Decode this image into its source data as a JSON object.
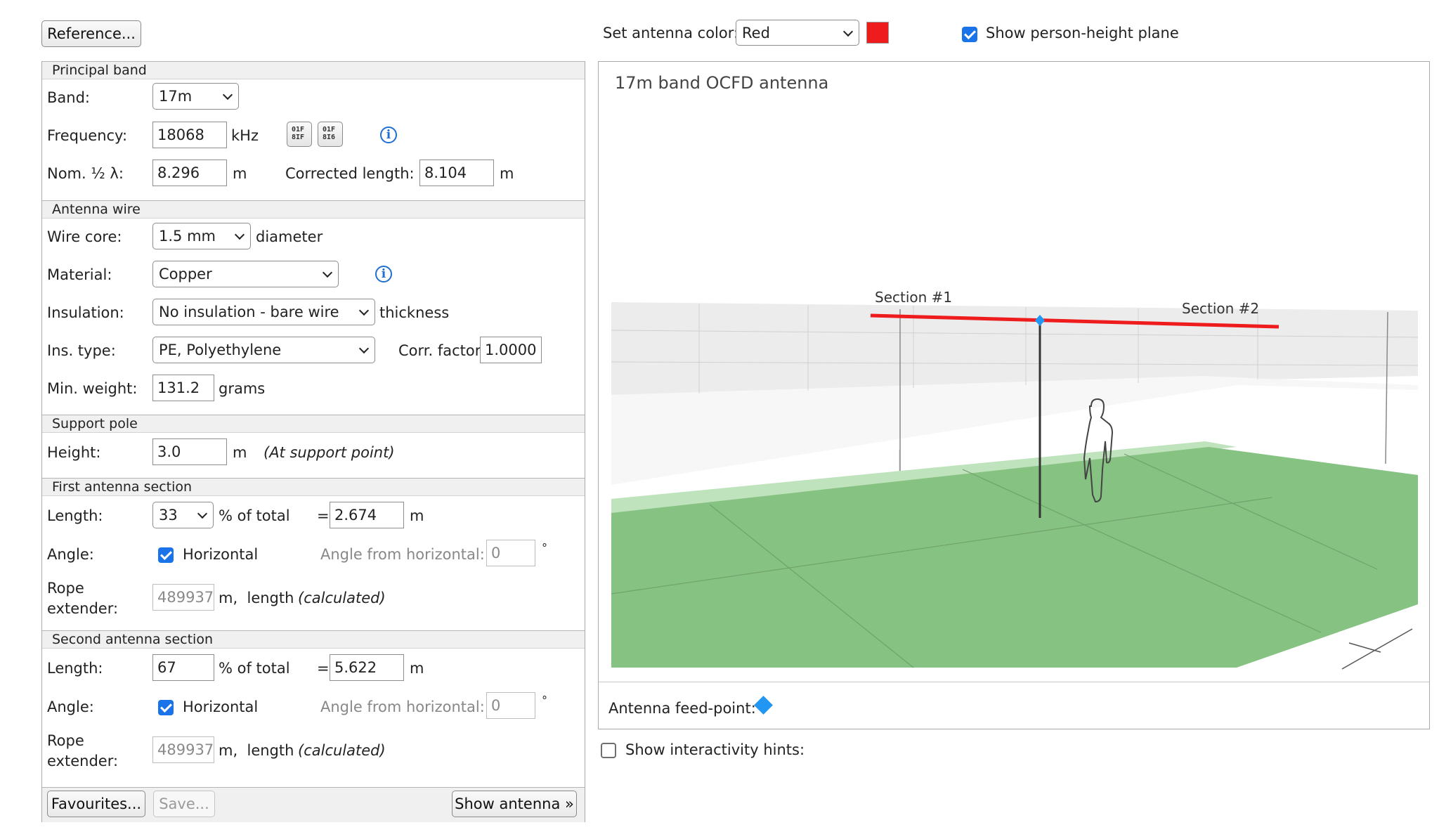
{
  "top": {
    "reference_label": "Reference...",
    "antenna_color_label": "Set antenna color:",
    "antenna_color_value": "Red",
    "antenna_color_swatch": "#ee1c1c",
    "person_plane_label": "Show person-height plane"
  },
  "principal": {
    "title": "Principal band",
    "band_label": "Band:",
    "band_value": "17m",
    "freq_label": "Frequency:",
    "freq_value": "18068",
    "freq_unit": "kHz",
    "nom_label": "Nom. ½ λ:",
    "nom_value": "8.296",
    "nom_unit": "m",
    "corr_label": "Corrected length:",
    "corr_value": "8.104",
    "corr_unit": "m"
  },
  "wire": {
    "title": "Antenna wire",
    "core_label": "Wire core:",
    "core_value": "1.5 mm",
    "core_suffix": "diameter",
    "material_label": "Material:",
    "material_value": "Copper",
    "insulation_label": "Insulation:",
    "insulation_value": "No insulation - bare wire",
    "insulation_suffix": "thickness",
    "instype_label": "Ins. type:",
    "instype_value": "PE, Polyethylene",
    "corrfactor_label": "Corr. factor:",
    "corrfactor_value": "1.0000",
    "weight_label": "Min. weight:",
    "weight_value": "131.2",
    "weight_unit": "grams"
  },
  "pole": {
    "title": "Support pole",
    "height_label": "Height:",
    "height_value": "3.0",
    "height_unit": "m",
    "height_note": "(At support point)"
  },
  "section1": {
    "title": "First antenna section",
    "length_label": "Length:",
    "length_value": "33",
    "pct_label": "% of total",
    "eq": "=",
    "len_m": "2.674",
    "len_unit": "m",
    "angle_label": "Angle:",
    "horizontal_label": "Horizontal",
    "angle_from_label": "Angle from horizontal:",
    "angle_value": "0",
    "deg": "°",
    "rope_label_1": "Rope",
    "rope_label_2": "extender:",
    "rope_value": "489937",
    "rope_unit": "m,  length",
    "rope_note": "(calculated)"
  },
  "section2": {
    "title": "Second antenna section",
    "length_label": "Length:",
    "length_value": "67",
    "pct_label": "% of total",
    "eq": "=",
    "len_m": "5.622",
    "len_unit": "m",
    "angle_label": "Angle:",
    "horizontal_label": "Horizontal",
    "angle_from_label": "Angle from horizontal:",
    "angle_value": "0",
    "deg": "°",
    "rope_label_1": "Rope",
    "rope_label_2": "extender:",
    "rope_value": "489937",
    "rope_unit": "m,  length",
    "rope_note": "(calculated)"
  },
  "footer": {
    "favourites_label": "Favourites...",
    "save_label": "Save...",
    "show_antenna_label": "Show antenna »"
  },
  "view": {
    "title": "17m band OCFD antenna",
    "section1_label": "Section #1",
    "section2_label": "Section #2",
    "feedpoint_label": "Antenna feed-point:",
    "hints_label": "Show interactivity hints:",
    "antenna_color": "#ee1c1c",
    "ground_color": "#86c282",
    "feedpoint_color": "#2196f3"
  }
}
